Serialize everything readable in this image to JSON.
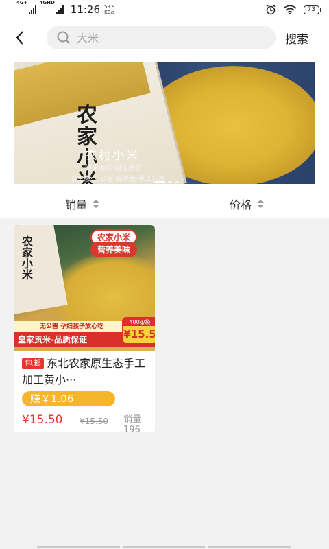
{
  "status_bar": {
    "net1": "4G+",
    "net2": "4GHD",
    "time": "11:26",
    "speed_value": "59.9",
    "speed_unit": "KB/s",
    "battery": "73"
  },
  "header": {
    "back_icon": "chevron-left-icon",
    "search_placeholder": "大米",
    "search_button": "搜索"
  },
  "banner": {
    "bag_text": "农家小米",
    "title": "农村小米",
    "subtitle1": "健康美味·超值品质",
    "subtitle2": "原生态·无公害·纯绿色·手工打磨",
    "slide_count": 3,
    "active_slide": 1
  },
  "sort": {
    "sales_label": "销量",
    "price_label": "价格"
  },
  "products": [
    {
      "image_text": {
        "bag": "农家小米",
        "tag1": "农家小米",
        "tag2": "营养美味",
        "strip": "无公害 孕妇孩子放心吃",
        "guarantee": "皇家贡米-品质保证",
        "weight": "400g/袋",
        "badge_price": "¥15.5"
      },
      "free_shipping": "包邮",
      "title": "东北农家原生态手工加工黄小···",
      "earn": "赚￥1.06",
      "price": "¥15.50",
      "original_price": "¥15.50",
      "sales": "销量 196"
    }
  ],
  "colors": {
    "accent_red": "#e8362c",
    "earn_orange": "#f6b629"
  }
}
